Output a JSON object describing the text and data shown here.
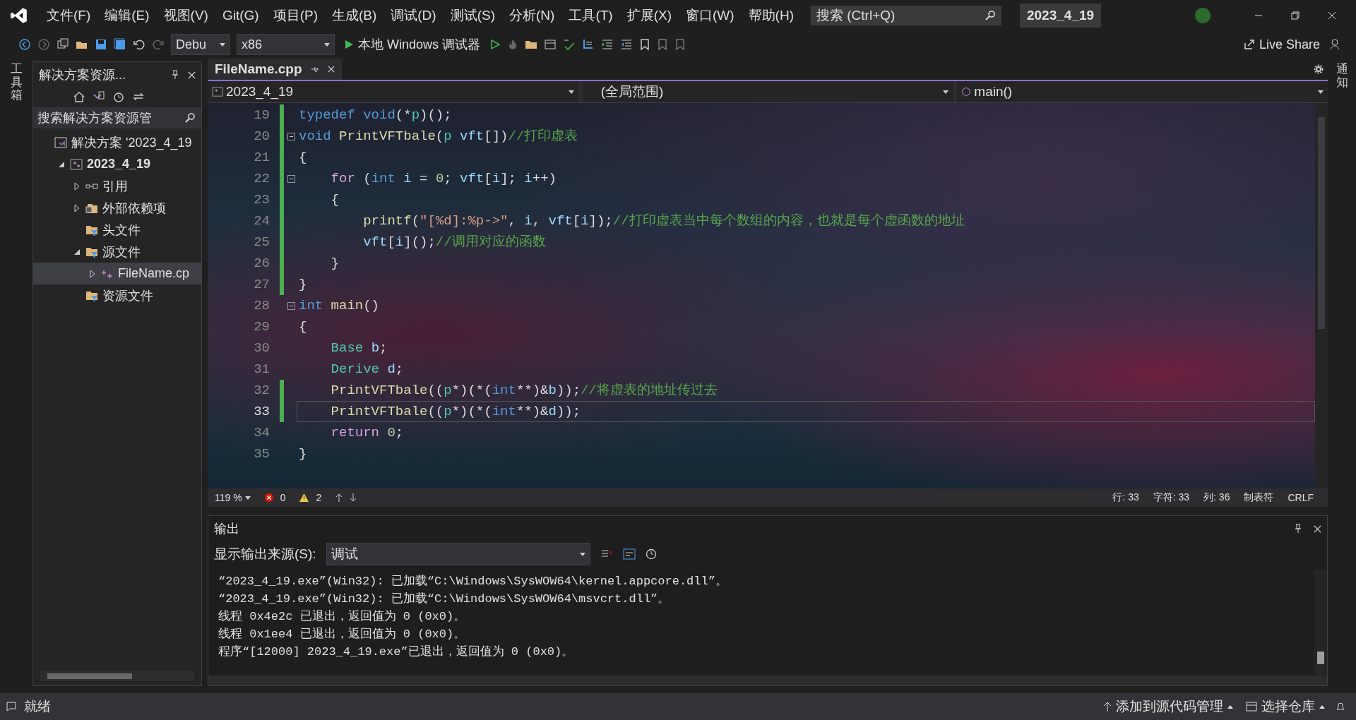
{
  "menu": [
    "文件(F)",
    "编辑(E)",
    "视图(V)",
    "Git(G)",
    "项目(P)",
    "生成(B)",
    "调试(D)",
    "测试(S)",
    "分析(N)",
    "工具(T)",
    "扩展(X)",
    "窗口(W)",
    "帮助(H)"
  ],
  "search": {
    "placeholder": "搜索 (Ctrl+Q)"
  },
  "solution_badge": "2023_4_19",
  "toolbar": {
    "configuration": "Debu",
    "platform": "x86",
    "run_label": "本地 Windows 调试器",
    "live_share": "Live Share"
  },
  "left_strip": "工具箱",
  "right_strip": "通知",
  "solution_explorer": {
    "title": "解决方案资源...",
    "search_placeholder": "搜索解决方案资源管",
    "tree": [
      {
        "label": "解决方案 '2023_4_19",
        "kind": "solution",
        "expandable": false,
        "selected": false,
        "bold": false,
        "children": [
          {
            "label": "2023_4_19",
            "kind": "project",
            "expandable": true,
            "expanded": true,
            "selected": false,
            "bold": true,
            "children": [
              {
                "label": "引用",
                "kind": "reference",
                "expandable": true,
                "expanded": false,
                "selected": false,
                "bold": false
              },
              {
                "label": "外部依赖项",
                "kind": "external",
                "expandable": true,
                "expanded": false,
                "selected": false,
                "bold": false
              },
              {
                "label": "头文件",
                "kind": "filter",
                "expandable": false,
                "selected": false,
                "bold": false
              },
              {
                "label": "源文件",
                "kind": "filter",
                "expandable": true,
                "expanded": true,
                "selected": false,
                "bold": false,
                "children": [
                  {
                    "label": "FileName.cp",
                    "kind": "cpp",
                    "expandable": true,
                    "expanded": false,
                    "selected": true,
                    "bold": false
                  }
                ]
              },
              {
                "label": "资源文件",
                "kind": "filter",
                "expandable": false,
                "selected": false,
                "bold": false
              }
            ]
          }
        ]
      }
    ]
  },
  "editor": {
    "tab": "FileName.cpp",
    "nav": {
      "project": "2023_4_19",
      "scope": "(全局范围)",
      "member": "main()"
    },
    "lines": [
      {
        "number": "19",
        "changed": true,
        "fold": false,
        "current": false,
        "tokens": [
          {
            "kind": "kw",
            "text": "typedef "
          },
          {
            "kind": "kw",
            "text": "void"
          },
          {
            "kind": "txt",
            "text": "(*"
          },
          {
            "kind": "type",
            "text": "p"
          },
          {
            "kind": "txt",
            "text": ")();"
          }
        ]
      },
      {
        "number": "20",
        "changed": true,
        "fold": true,
        "current": false,
        "tokens": [
          {
            "kind": "kw",
            "text": "void "
          },
          {
            "kind": "fn",
            "text": "PrintVFTbale"
          },
          {
            "kind": "txt",
            "text": "("
          },
          {
            "kind": "type",
            "text": "p "
          },
          {
            "kind": "var",
            "text": "vft"
          },
          {
            "kind": "txt",
            "text": "[])"
          },
          {
            "kind": "cm",
            "text": "//打印虚表"
          }
        ]
      },
      {
        "number": "21",
        "changed": true,
        "fold": false,
        "current": false,
        "tokens": [
          {
            "kind": "txt",
            "text": "{"
          }
        ]
      },
      {
        "number": "22",
        "changed": true,
        "fold": true,
        "current": false,
        "tokens": [
          {
            "kind": "ctl",
            "text": "    for"
          },
          {
            "kind": "txt",
            "text": " ("
          },
          {
            "kind": "kw",
            "text": "int "
          },
          {
            "kind": "var",
            "text": "i"
          },
          {
            "kind": "txt",
            "text": " = "
          },
          {
            "kind": "num",
            "text": "0"
          },
          {
            "kind": "txt",
            "text": "; "
          },
          {
            "kind": "var",
            "text": "vft"
          },
          {
            "kind": "txt",
            "text": "["
          },
          {
            "kind": "var",
            "text": "i"
          },
          {
            "kind": "txt",
            "text": "]; "
          },
          {
            "kind": "var",
            "text": "i"
          },
          {
            "kind": "txt",
            "text": "++)"
          }
        ]
      },
      {
        "number": "23",
        "changed": true,
        "fold": false,
        "current": false,
        "tokens": [
          {
            "kind": "txt",
            "text": "    {"
          }
        ]
      },
      {
        "number": "24",
        "changed": true,
        "fold": false,
        "current": false,
        "tokens": [
          {
            "kind": "fn",
            "text": "        printf"
          },
          {
            "kind": "txt",
            "text": "("
          },
          {
            "kind": "str",
            "text": "\"[%d]:%p->\""
          },
          {
            "kind": "txt",
            "text": ", "
          },
          {
            "kind": "var",
            "text": "i"
          },
          {
            "kind": "txt",
            "text": ", "
          },
          {
            "kind": "var",
            "text": "vft"
          },
          {
            "kind": "txt",
            "text": "["
          },
          {
            "kind": "var",
            "text": "i"
          },
          {
            "kind": "txt",
            "text": "]);"
          },
          {
            "kind": "cm",
            "text": "//打印虚表当中每个数组的内容，也就是每个虚函数的地址"
          }
        ]
      },
      {
        "number": "25",
        "changed": true,
        "fold": false,
        "current": false,
        "tokens": [
          {
            "kind": "var",
            "text": "        vft"
          },
          {
            "kind": "txt",
            "text": "["
          },
          {
            "kind": "var",
            "text": "i"
          },
          {
            "kind": "txt",
            "text": "]();"
          },
          {
            "kind": "cm",
            "text": "//调用对应的函数"
          }
        ]
      },
      {
        "number": "26",
        "changed": true,
        "fold": false,
        "current": false,
        "tokens": [
          {
            "kind": "txt",
            "text": "    }"
          }
        ]
      },
      {
        "number": "27",
        "changed": true,
        "fold": false,
        "current": false,
        "tokens": [
          {
            "kind": "txt",
            "text": "}"
          }
        ]
      },
      {
        "number": "28",
        "changed": false,
        "fold": true,
        "current": false,
        "tokens": [
          {
            "kind": "kw",
            "text": "int "
          },
          {
            "kind": "fn",
            "text": "main"
          },
          {
            "kind": "txt",
            "text": "()"
          }
        ]
      },
      {
        "number": "29",
        "changed": false,
        "fold": false,
        "current": false,
        "tokens": [
          {
            "kind": "txt",
            "text": "{"
          }
        ]
      },
      {
        "number": "30",
        "changed": false,
        "fold": false,
        "current": false,
        "tokens": [
          {
            "kind": "type",
            "text": "    Base "
          },
          {
            "kind": "var",
            "text": "b"
          },
          {
            "kind": "txt",
            "text": ";"
          }
        ]
      },
      {
        "number": "31",
        "changed": false,
        "fold": false,
        "current": false,
        "tokens": [
          {
            "kind": "type",
            "text": "    Derive "
          },
          {
            "kind": "var",
            "text": "d"
          },
          {
            "kind": "txt",
            "text": ";"
          }
        ]
      },
      {
        "number": "32",
        "changed": true,
        "fold": false,
        "current": false,
        "tokens": [
          {
            "kind": "fn",
            "text": "    PrintVFTbale"
          },
          {
            "kind": "txt",
            "text": "(("
          },
          {
            "kind": "type",
            "text": "p"
          },
          {
            "kind": "txt",
            "text": "*)(*("
          },
          {
            "kind": "kw",
            "text": "int"
          },
          {
            "kind": "txt",
            "text": "**)&"
          },
          {
            "kind": "var",
            "text": "b"
          },
          {
            "kind": "txt",
            "text": "));"
          },
          {
            "kind": "cm",
            "text": "//将虚表的地址传过去"
          }
        ]
      },
      {
        "number": "33",
        "changed": true,
        "fold": false,
        "current": true,
        "tokens": [
          {
            "kind": "fn",
            "text": "    PrintVFTbale"
          },
          {
            "kind": "txt",
            "text": "(("
          },
          {
            "kind": "type",
            "text": "p"
          },
          {
            "kind": "txt",
            "text": "*)(*("
          },
          {
            "kind": "kw",
            "text": "int"
          },
          {
            "kind": "txt",
            "text": "**)&"
          },
          {
            "kind": "var",
            "text": "d"
          },
          {
            "kind": "txt",
            "text": "));"
          }
        ]
      },
      {
        "number": "34",
        "changed": false,
        "fold": false,
        "current": false,
        "tokens": [
          {
            "kind": "ctl",
            "text": "    return "
          },
          {
            "kind": "num",
            "text": "0"
          },
          {
            "kind": "txt",
            "text": ";"
          }
        ]
      },
      {
        "number": "35",
        "changed": false,
        "fold": false,
        "current": false,
        "tokens": [
          {
            "kind": "txt",
            "text": "}"
          }
        ]
      }
    ],
    "status": {
      "zoom": "119 %",
      "errors": "0",
      "warnings": "2",
      "line": "行: 33",
      "char": "字符: 33",
      "col": "列: 36",
      "indent": "制表符",
      "eol": "CRLF"
    }
  },
  "output": {
    "title": "输出",
    "source_label": "显示输出来源(S):",
    "source": "调试",
    "lines": [
      "“2023_4_19.exe”(Win32): 已加载“C:\\Windows\\SysWOW64\\kernel.appcore.dll”。",
      "“2023_4_19.exe”(Win32): 已加载“C:\\Windows\\SysWOW64\\msvcrt.dll”。",
      "线程 0x4e2c 已退出，返回值为 0 (0x0)。",
      "线程 0x1ee4 已退出，返回值为 0 (0x0)。",
      "程序“[12000] 2023_4_19.exe”已退出，返回值为 0 (0x0)。"
    ]
  },
  "status_bar": {
    "state": "就绪",
    "source_control": "添加到源代码管理",
    "repository": "选择仓库"
  }
}
